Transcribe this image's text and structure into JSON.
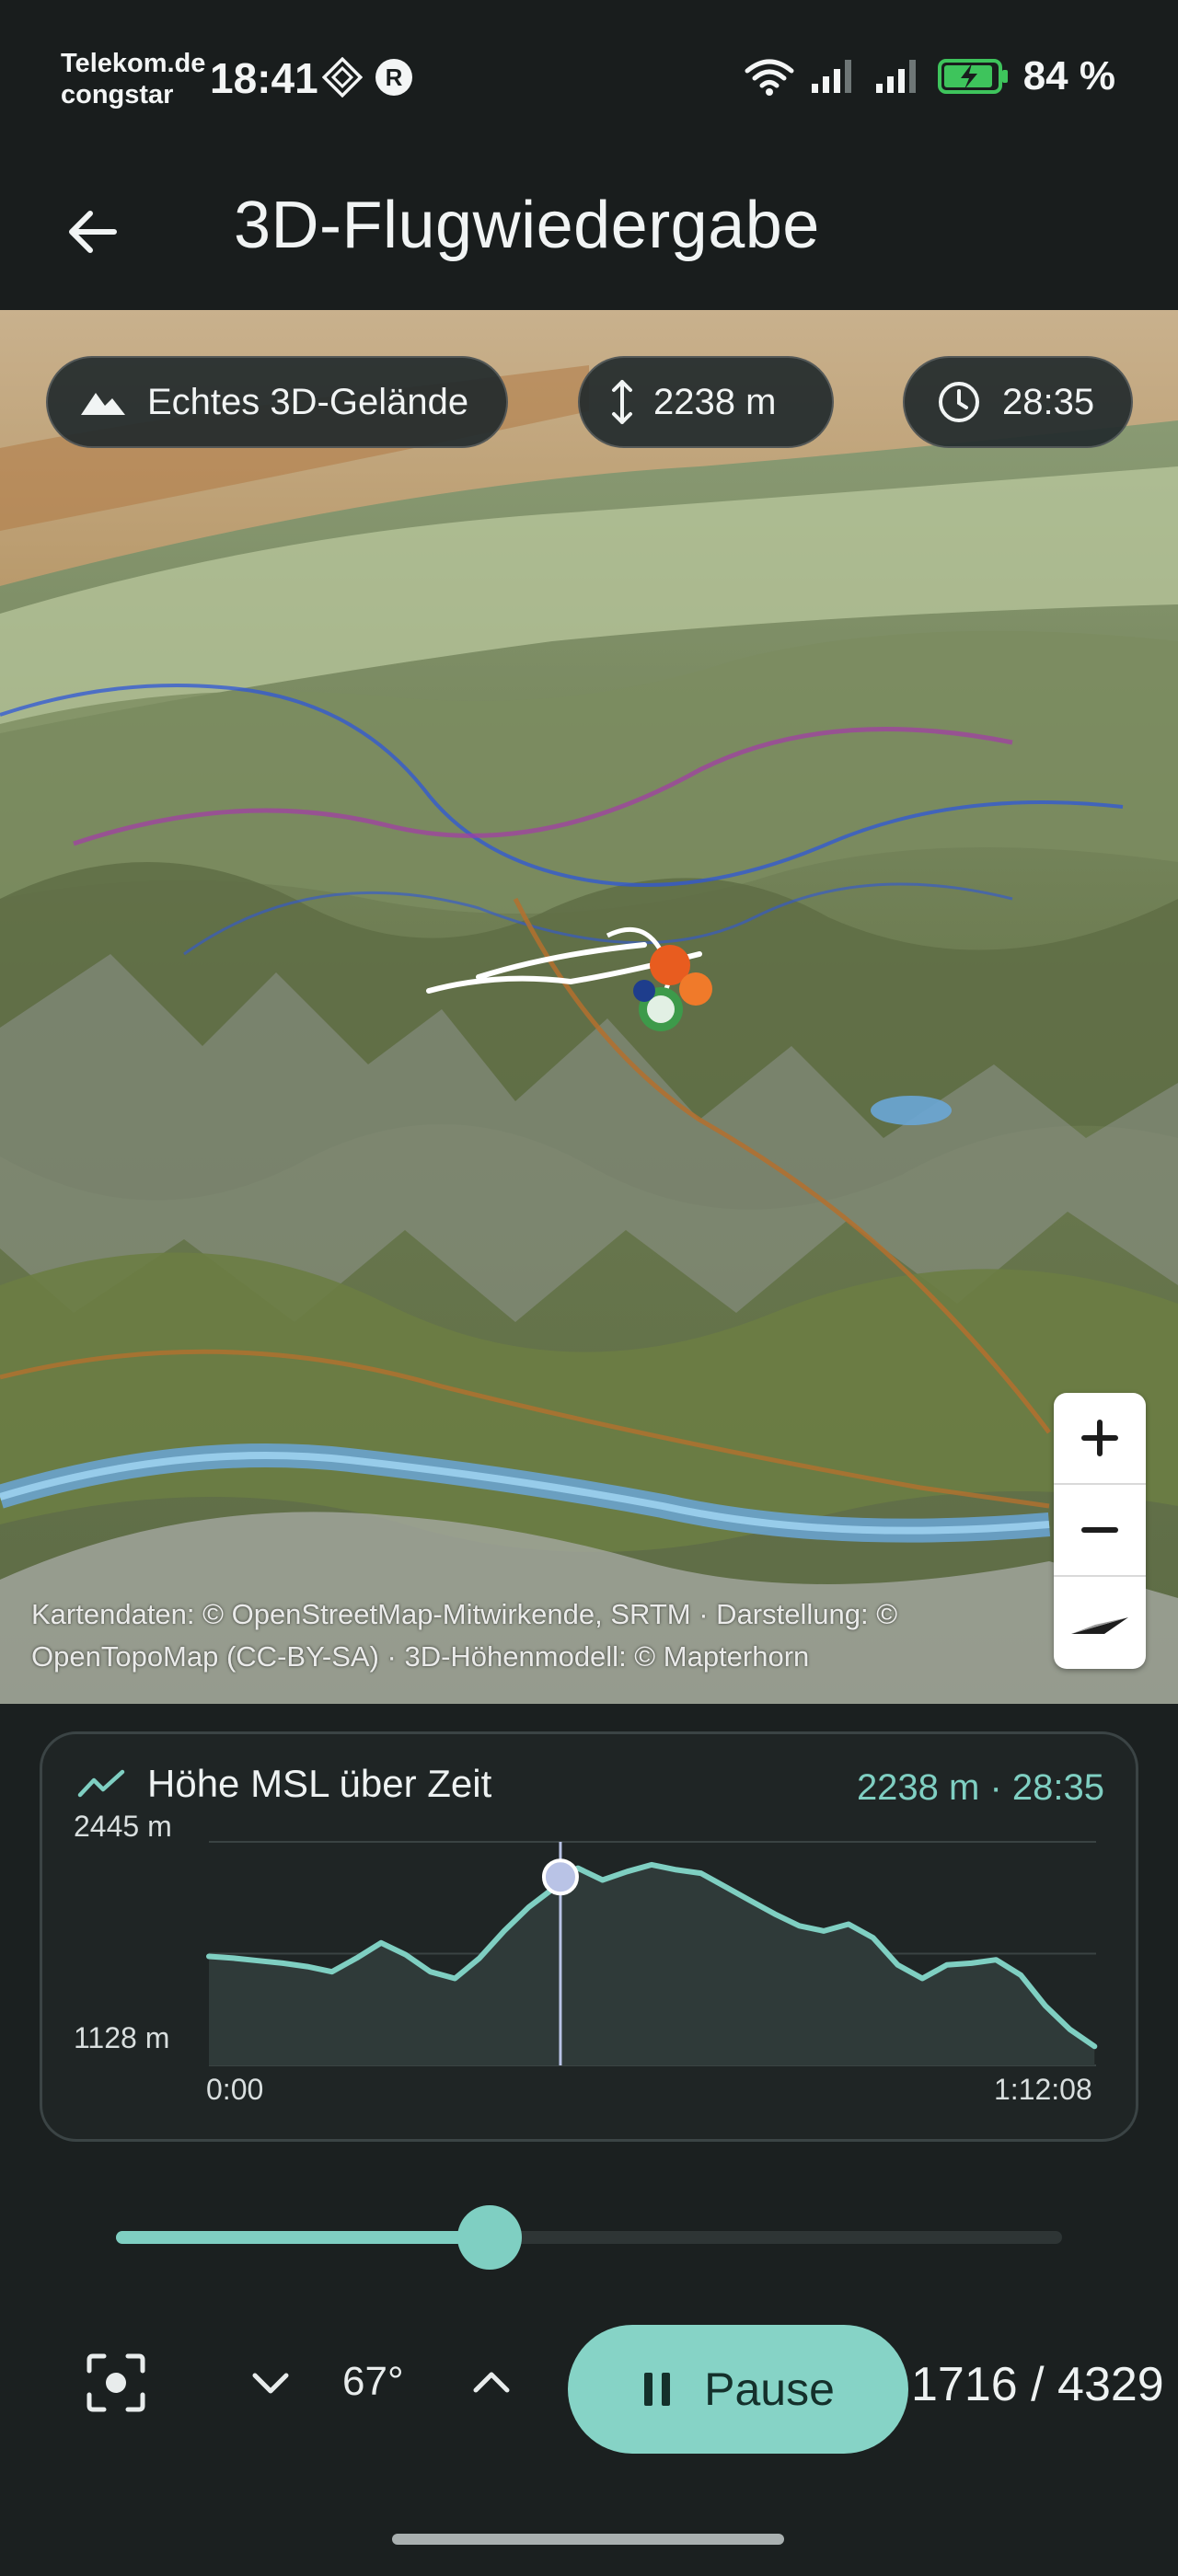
{
  "status_bar": {
    "carrier_line1": "Telekom.de",
    "carrier_line2": "congstar",
    "time": "18:41",
    "battery": "84 %"
  },
  "app_bar": {
    "title": "3D-Flugwiedergabe",
    "back_icon": "arrow-left-icon"
  },
  "map": {
    "chips": {
      "terrain": "Echtes 3D-Gelände",
      "altitude": "2238 m",
      "time": "28:35"
    },
    "attribution_line1": "Kartendaten: © OpenStreetMap-Mitwirkende, SRTM · Darstellung: ©",
    "attribution_line2": "OpenTopoMap (CC-BY-SA) · 3D-Höhenmodell: © Mapterhorn",
    "zoom_in_icon": "plus-icon",
    "zoom_out_icon": "minus-icon",
    "compass_icon": "compass-icon"
  },
  "elevation_chart": {
    "title": "Höhe MSL über Zeit",
    "readout": "2238 m · 28:35",
    "y_max_label": "2445 m",
    "y_min_label": "1128 m",
    "x_start_label": "0:00",
    "x_end_label": "1:12:08",
    "colors": {
      "line": "#7fcfc2",
      "fill": "#2f3a39",
      "cursor": "#b9c3e6"
    }
  },
  "chart_data": {
    "type": "area",
    "title": "Höhe MSL über Zeit",
    "xlabel": "",
    "ylabel": "",
    "xlim_minutes": [
      0,
      72.13
    ],
    "ylim": [
      1128,
      2445
    ],
    "cursor": {
      "x_minutes": 28.58,
      "y": 2238
    },
    "x_minutes": [
      0,
      2,
      4,
      6,
      8,
      10,
      12,
      14,
      16,
      18,
      20,
      22,
      24,
      26,
      28,
      28.6,
      30,
      32,
      34,
      36,
      38,
      40,
      42,
      44,
      46,
      48,
      50,
      52,
      54,
      56,
      58,
      60,
      62,
      64,
      66,
      68,
      70,
      72
    ],
    "y": [
      1770,
      1760,
      1745,
      1730,
      1710,
      1680,
      1760,
      1850,
      1780,
      1680,
      1640,
      1760,
      1920,
      2060,
      2170,
      2238,
      2290,
      2220,
      2270,
      2310,
      2280,
      2260,
      2180,
      2100,
      2020,
      1950,
      1920,
      1960,
      1880,
      1720,
      1640,
      1720,
      1730,
      1750,
      1660,
      1480,
      1340,
      1240
    ]
  },
  "playback": {
    "progress": 0.395,
    "tilt": "67°",
    "pause_label": "Pause",
    "frame_counter": "1716 / 4329"
  }
}
